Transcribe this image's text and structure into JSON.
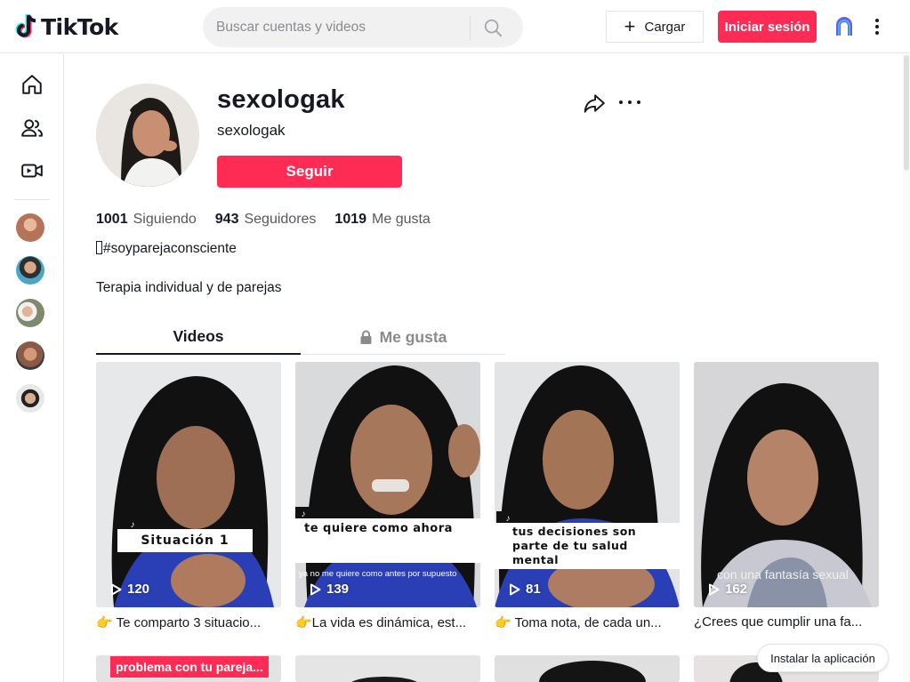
{
  "header": {
    "logo_text": "TikTok",
    "search_placeholder": "Buscar cuentas y videos",
    "upload_label": "Cargar",
    "login_label": "Iniciar sesión"
  },
  "sidebar": {
    "nav": [
      {
        "name": "home-icon"
      },
      {
        "name": "following-icon"
      },
      {
        "name": "live-icon"
      }
    ],
    "accounts": [
      {
        "name": "account-avatar-1",
        "color": "#b5745a"
      },
      {
        "name": "account-avatar-2",
        "color": "#4aa6c9"
      },
      {
        "name": "account-avatar-3",
        "color": "#7d8a6e"
      },
      {
        "name": "account-avatar-4",
        "color": "#8a5a44"
      },
      {
        "name": "account-avatar-5",
        "color": "#6a6f78"
      }
    ]
  },
  "profile": {
    "username": "sexologak",
    "nickname": "sexologak",
    "follow_label": "Seguir",
    "stats": {
      "following_count": "1001",
      "following_label": "Siguiendo",
      "followers_count": "943",
      "followers_label": "Seguidores",
      "likes_count": "1019",
      "likes_label": "Me gusta"
    },
    "bio_line1": "#soyparejaconsciente",
    "bio_line2": "Terapia individual y de parejas"
  },
  "tabs": {
    "videos": "Videos",
    "liked": "Me gusta"
  },
  "videos": [
    {
      "views": "120",
      "caption": "👉 Te comparto 3 situacio...",
      "overlay": "Situación 1"
    },
    {
      "views": "139",
      "caption": "👉La vida es dinámica, est...",
      "overlay": "te quiere como ahora",
      "sub": "ya no me quiere como antes por supuesto"
    },
    {
      "views": "81",
      "caption": "👉 Toma nota, de cada un...",
      "overlay": "tus decisiones son parte de tu salud mental"
    },
    {
      "views": "162",
      "caption": "¿Crees que cumplir una fa...",
      "sub": "con una fantasía sexual"
    }
  ],
  "next_row": {
    "red_label": "problema con tu pareja..."
  },
  "install_label": "Instalar la aplicación",
  "colors": {
    "accent": "#fe2c55",
    "text": "#161823",
    "muted": "#8a8b91"
  }
}
